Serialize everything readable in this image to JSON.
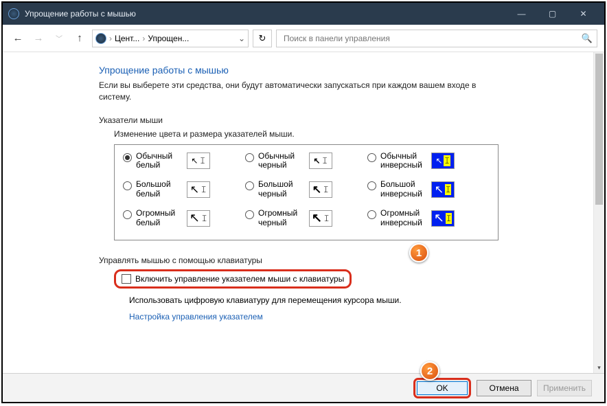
{
  "window": {
    "title": "Упрощение работы с мышью"
  },
  "nav": {
    "crumb1": "Цент...",
    "crumb2": "Упрощен...",
    "search_placeholder": "Поиск в панели управления"
  },
  "main": {
    "title": "Упрощение работы с мышью",
    "subtitle": "Если вы выберете эти средства, они будут автоматически запускаться при каждом вашем входе в систему."
  },
  "pointers": {
    "group_label": "Указатели мыши",
    "group_sub": "Изменение цвета и размера указателей мыши.",
    "opts": [
      {
        "a": "Обычный белый",
        "b": "Обычный черный",
        "c": "Обычный инверсный"
      },
      {
        "a": "Большой белый",
        "b": "Большой черный",
        "c": "Большой инверсный"
      },
      {
        "a": "Огромный белый",
        "b": "Огромный черный",
        "c": "Огромный инверсный"
      }
    ]
  },
  "keyboard": {
    "group_label": "Управлять мышью с помощью клавиатуры",
    "checkbox_label": "Включить управление указателем мыши с клавиатуры",
    "desc": "Использовать цифровую клавиатуру для перемещения курсора мыши.",
    "link": "Настройка управления указателем"
  },
  "footer": {
    "ok": "OK",
    "cancel": "Отмена",
    "apply": "Применить"
  },
  "callouts": {
    "one": "1",
    "two": "2"
  }
}
